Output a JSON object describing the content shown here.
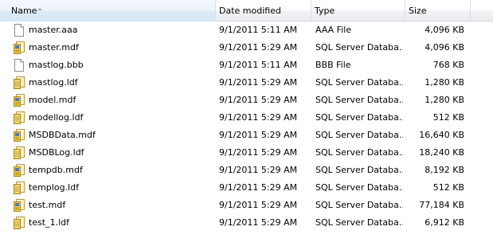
{
  "columns": {
    "name": "Name",
    "date": "Date modified",
    "type": "Type",
    "size": "Size"
  },
  "files": [
    {
      "icon": "blank-file-icon",
      "name": "master.aaa",
      "date": "9/1/2011 5:11 AM",
      "type": "AAA File",
      "size": "4,096 KB"
    },
    {
      "icon": "database-file-icon",
      "name": "master.mdf",
      "date": "9/1/2011 5:29 AM",
      "type": "SQL Server Databa...",
      "size": "4,096 KB"
    },
    {
      "icon": "blank-file-icon",
      "name": "mastlog.bbb",
      "date": "9/1/2011 5:11 AM",
      "type": "BBB File",
      "size": "768 KB"
    },
    {
      "icon": "database-log-icon",
      "name": "mastlog.ldf",
      "date": "9/1/2011 5:29 AM",
      "type": "SQL Server Databa...",
      "size": "1,280 KB"
    },
    {
      "icon": "database-file-icon",
      "name": "model.mdf",
      "date": "9/1/2011 5:29 AM",
      "type": "SQL Server Databa...",
      "size": "1,280 KB"
    },
    {
      "icon": "database-log-icon",
      "name": "modellog.ldf",
      "date": "9/1/2011 5:29 AM",
      "type": "SQL Server Databa...",
      "size": "512 KB"
    },
    {
      "icon": "database-file-icon",
      "name": "MSDBData.mdf",
      "date": "9/1/2011 5:29 AM",
      "type": "SQL Server Databa...",
      "size": "16,640 KB"
    },
    {
      "icon": "database-log-icon",
      "name": "MSDBLog.ldf",
      "date": "9/1/2011 5:29 AM",
      "type": "SQL Server Databa...",
      "size": "18,240 KB"
    },
    {
      "icon": "database-file-icon",
      "name": "tempdb.mdf",
      "date": "9/1/2011 5:29 AM",
      "type": "SQL Server Databa...",
      "size": "8,192 KB"
    },
    {
      "icon": "database-log-icon",
      "name": "templog.ldf",
      "date": "9/1/2011 5:29 AM",
      "type": "SQL Server Databa...",
      "size": "512 KB"
    },
    {
      "icon": "database-file-icon",
      "name": "test.mdf",
      "date": "9/1/2011 5:29 AM",
      "type": "SQL Server Databa...",
      "size": "77,184 KB"
    },
    {
      "icon": "database-log-icon",
      "name": "test_1.ldf",
      "date": "9/1/2011 5:29 AM",
      "type": "SQL Server Databa...",
      "size": "6,912 KB"
    }
  ]
}
